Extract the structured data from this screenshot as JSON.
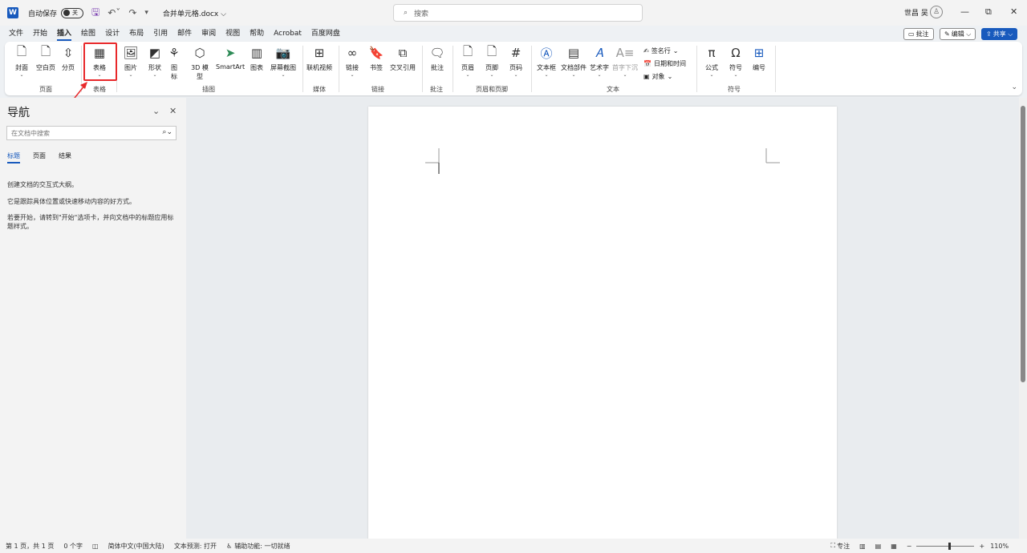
{
  "titlebar": {
    "autosave_label": "自动保存",
    "autosave_state": "关",
    "doc_title": "合并单元格.docx ⌵",
    "search_placeholder": "搜索",
    "user_name": "世昌 吴"
  },
  "tabs": [
    "文件",
    "开始",
    "插入",
    "绘图",
    "设计",
    "布局",
    "引用",
    "邮件",
    "审阅",
    "视图",
    "帮助",
    "Acrobat",
    "百度网盘"
  ],
  "active_tab": "插入",
  "right_buttons": {
    "comments": "批注",
    "editing": "编辑 ⌵",
    "share": "共享 ⌵"
  },
  "ribbon": {
    "pages": {
      "cover": "封面",
      "blank": "空白页",
      "break": "分页",
      "group": "页面"
    },
    "table": {
      "table": "表格",
      "group": "表格"
    },
    "illustrations": {
      "picture": "图片",
      "shapes": "形状",
      "icons1": "图",
      "icons2": "标",
      "model1": "3D 模",
      "model2": "型",
      "smartart": "SmartArt",
      "chart": "图表",
      "screenshot": "屏幕截图",
      "group": "插图"
    },
    "media": {
      "video": "联机视频",
      "group": "媒体"
    },
    "links": {
      "link": "链接",
      "bookmark": "书签",
      "crossref": "交叉引用",
      "group": "链接"
    },
    "comments": {
      "comment": "批注",
      "group": "批注"
    },
    "headerfooter": {
      "header": "页眉",
      "footer": "页脚",
      "pagenum": "页码",
      "group": "页眉和页脚"
    },
    "text": {
      "textbox": "文本框",
      "parts": "文档部件",
      "wordart": "艺术字",
      "dropcap": "首字下沉",
      "signature": "签名行",
      "datetime": "日期和时间",
      "object": "对象",
      "group": "文本"
    },
    "symbols": {
      "equation": "公式",
      "symbol": "符号",
      "number": "编号",
      "group": "符号"
    }
  },
  "nav": {
    "title": "导航",
    "search_placeholder": "在文档中搜索",
    "tabs": [
      "标题",
      "页面",
      "结果"
    ],
    "text1": "创建文档的交互式大纲。",
    "text2": "它是跟踪具体位置或快速移动内容的好方式。",
    "text3": "若要开始，请转到\"开始\"选项卡，并向文档中的标题应用标题样式。"
  },
  "status": {
    "page": "第 1 页，共 1 页",
    "words": "0 个字",
    "language": "简体中文(中国大陆)",
    "prediction": "文本预测: 打开",
    "accessibility": "辅助功能: 一切就绪",
    "focus": "专注",
    "zoom": "110%"
  }
}
